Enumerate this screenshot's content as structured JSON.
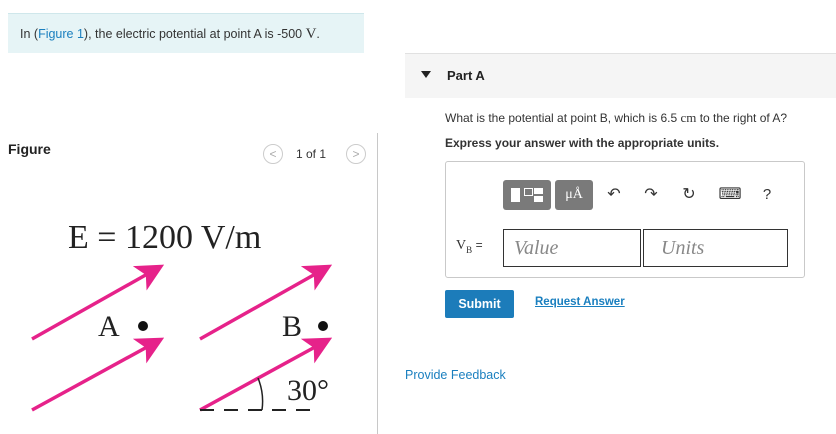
{
  "banner": {
    "prefix": "In (",
    "link": "Figure 1",
    "suffix": "), the electric potential at point A is -500 ",
    "unit": "V",
    "end": "."
  },
  "figure": {
    "title": "Figure",
    "pager_text": "1 of 1",
    "prev_symbol": "<",
    "next_symbol": ">",
    "equation": "E = 1200 V/m",
    "point_a": "A",
    "point_b": "B",
    "angle": "30°",
    "arrow_color": "#e6228a"
  },
  "part": {
    "title": "Part A",
    "question_prefix": "What is the potential at point B, which is 6.5 ",
    "question_unit": "cm",
    "question_suffix": " to the right of A?",
    "instruction": "Express your answer with the appropriate units.",
    "toolbar": {
      "units_label": "μÅ",
      "undo_icon": "↶",
      "redo_icon": "↷",
      "reset_icon": "↻",
      "keyboard_icon": "⌨",
      "help_label": "?"
    },
    "answer_var": "V",
    "answer_sub": "B",
    "answer_eq": "=",
    "value_placeholder": "Value",
    "units_placeholder": "Units",
    "submit_label": "Submit",
    "request_label": "Request Answer"
  },
  "feedback_label": "Provide Feedback",
  "colors": {
    "accent": "#1c7cba",
    "link": "#1a7fbf",
    "banner_bg": "#e6f4f6"
  }
}
